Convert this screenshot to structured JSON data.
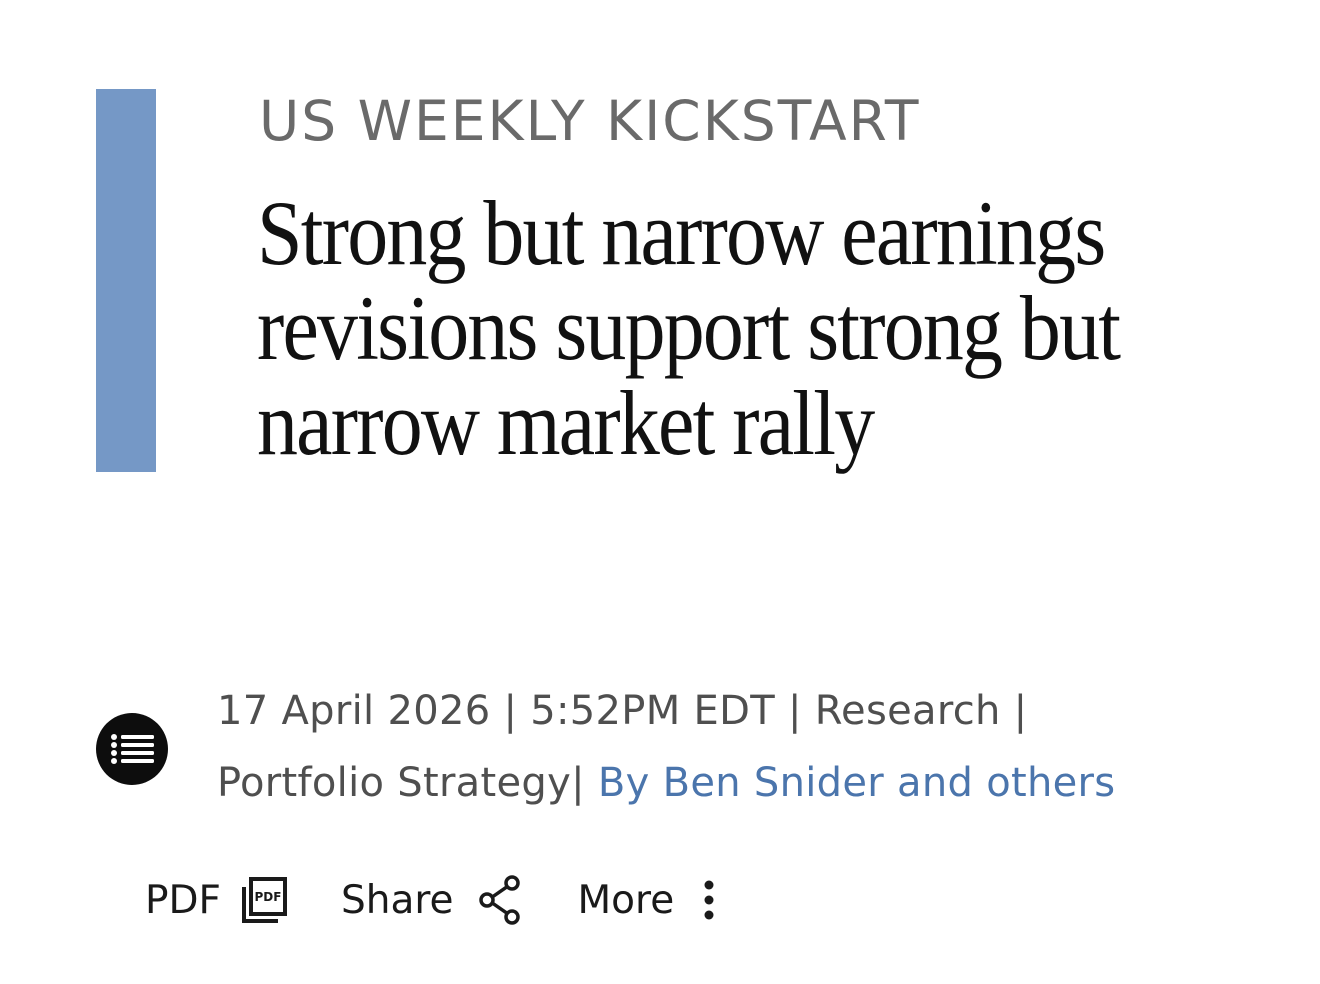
{
  "header": {
    "kicker": "US WEEKLY KICKSTART",
    "headline": "Strong but narrow earnings revisions support strong but narrow market rally"
  },
  "meta": {
    "date": "17 April 2026",
    "time": "5:52PM EDT",
    "category": "Research",
    "subcategory": "Portfolio Strategy",
    "author_link": "By Ben Snider and others",
    "separator": " | "
  },
  "actions": {
    "pdf_label": "PDF",
    "pdf_icon_text": "PDF",
    "share_label": "Share",
    "more_label": "More"
  },
  "icons": {
    "toc": "list-icon",
    "pdf": "pdf-document-icon",
    "share": "share-icon",
    "more": "vertical-ellipsis-icon"
  },
  "colors": {
    "accent_bar": "#7598c6",
    "author_link": "#4b75ac",
    "kicker": "#6a6a6a",
    "headline": "#111111"
  }
}
